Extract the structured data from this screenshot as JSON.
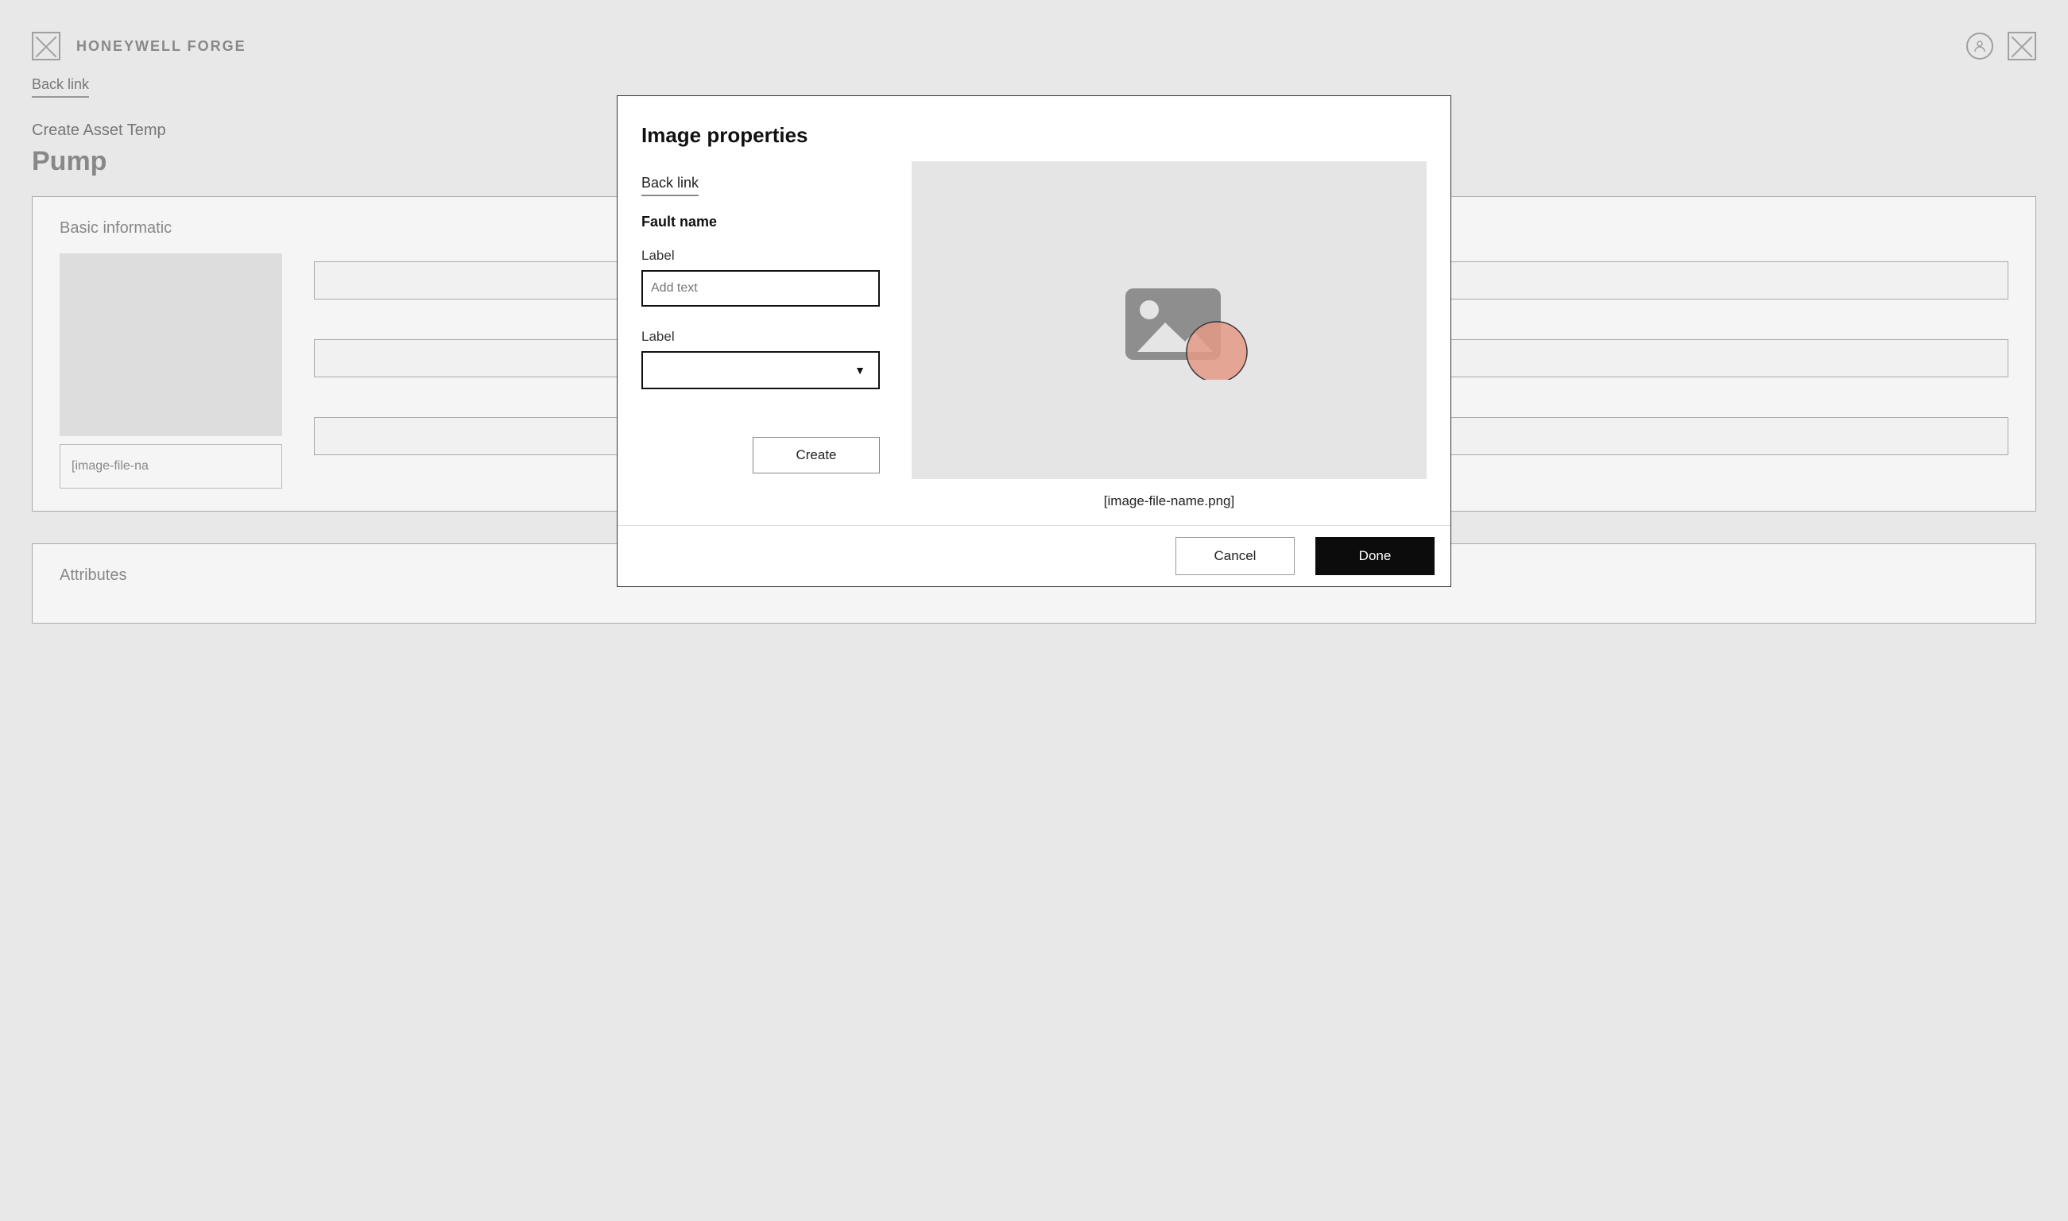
{
  "header": {
    "brand": "HONEYWELL FORGE"
  },
  "background": {
    "back_link": "Back link",
    "crumb": "Create Asset Temp",
    "page_title": "Pump",
    "section_basic": "Basic informatic",
    "filename": "[image-file-na",
    "section_attributes": "Attributes"
  },
  "modal": {
    "title": "Image properties",
    "back_link": "Back link",
    "subtitle": "Fault name",
    "label1": "Label",
    "input1_placeholder": "Add text",
    "label2": "Label",
    "select_value": "",
    "create_button": "Create",
    "preview_caption": "[image-file-name.png]",
    "cancel_button": "Cancel",
    "done_button": "Done"
  }
}
